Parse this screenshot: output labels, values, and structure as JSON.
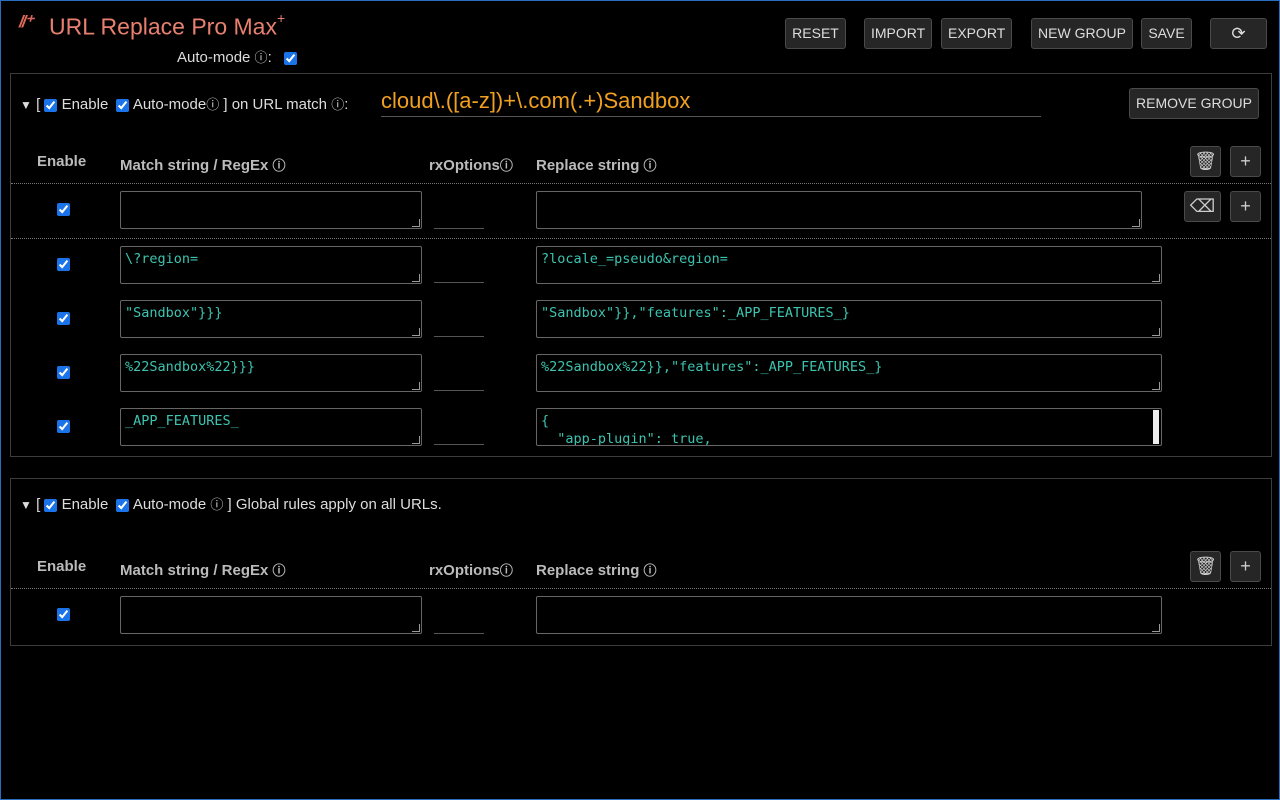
{
  "header": {
    "logo_glyph": "//⁺",
    "title": "URL Replace Pro Max",
    "title_sup": "+",
    "auto_mode_label": "Auto-mode",
    "info_glyph": "ⓘ",
    "auto_mode_checked": true,
    "buttons": {
      "reset": "RESET",
      "import": "IMPORT",
      "export": "EXPORT",
      "new_group": "NEW GROUP",
      "save": "SAVE",
      "refresh_icon": "refresh-icon"
    }
  },
  "labels": {
    "enable": "Enable",
    "auto_mode": "Auto-mode",
    "bracket_open": "[",
    "on_url_match": "] on URL match",
    "global_text": "] Global rules apply on all URLs.",
    "col_enable": "Enable",
    "col_match": "Match string / RegEx",
    "col_rx": "rxOptions",
    "col_replace": "Replace string",
    "remove_group": "REMOVE GROUP",
    "colon": ":"
  },
  "group1": {
    "url_match": "cloud\\.([a-z])+\\.com(.+)Sandbox",
    "rows": [
      {
        "enabled": true,
        "match": "",
        "rx": "",
        "replace": ""
      },
      {
        "enabled": true,
        "match": "\\?region=",
        "rx": "",
        "replace": "?locale_=pseudo&region="
      },
      {
        "enabled": true,
        "match": "\"Sandbox\"}}}",
        "rx": "",
        "replace": "\"Sandbox\"}},\"features\":_APP_FEATURES_}"
      },
      {
        "enabled": true,
        "match": "%22Sandbox%22}}}",
        "rx": "",
        "replace": "%22Sandbox%22}},\"features\":_APP_FEATURES_}"
      },
      {
        "enabled": true,
        "match": "_APP_FEATURES_",
        "rx": "",
        "replace": "{\n  \"app-plugin\": true,"
      }
    ]
  },
  "group2": {
    "rows": [
      {
        "enabled": true,
        "match": "",
        "rx": "",
        "replace": ""
      }
    ]
  },
  "icons": {
    "trash": "trash-icon",
    "plus": "plus-icon",
    "clear": "backspace-icon",
    "collapse": "triangle-down-icon"
  }
}
